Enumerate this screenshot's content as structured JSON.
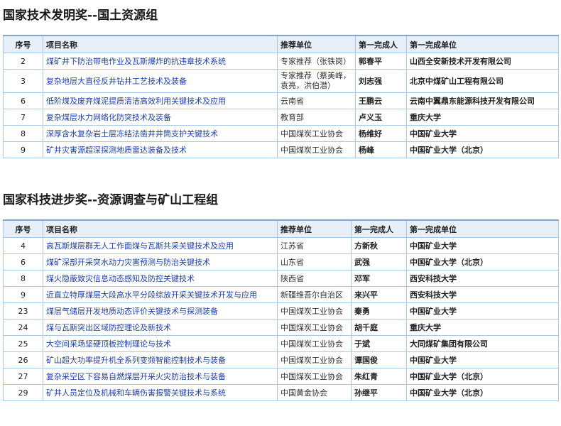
{
  "section1": {
    "title": "国家技术发明奖--国土资源组",
    "headers": [
      "序号",
      "项目名称",
      "推荐单位",
      "第一完成人",
      "第一完成单位"
    ],
    "rows": [
      {
        "no": "2",
        "name": "煤矿井下防治带电作业及瓦斯爆炸的抗违章技术系统",
        "unit": "专家推荐（张铁岗）",
        "person": "郭春平",
        "org": "山西全安新技术开发有限公司"
      },
      {
        "no": "3",
        "name": "复杂地层大直径反井钻井工艺技术及装备",
        "unit": "专家推荐（蔡美峰，袁亮，洪伯潜）",
        "person": "刘志强",
        "org": "北京中煤矿山工程有限公司"
      },
      {
        "no": "6",
        "name": "低阶煤及废弃煤泥提质清洁高效利用关键技术及应用",
        "unit": "云南省",
        "person": "王鹏云",
        "org": "云南中翼鼎东能源科技开发有限公司"
      },
      {
        "no": "7",
        "name": "复杂煤层水力网络化防突技术及装备",
        "unit": "教育部",
        "person": "卢义玉",
        "org": "重庆大学"
      },
      {
        "no": "8",
        "name": "深厚含水复杂岩土层冻结法凿井井筒支护关键技术",
        "unit": "中国煤炭工业协会",
        "person": "杨维好",
        "org": "中国矿业大学"
      },
      {
        "no": "9",
        "name": "矿井灾害源超深探测地质雷达装备及技术",
        "unit": "中国煤炭工业协会",
        "person": "杨峰",
        "org": "中国矿业大学（北京）"
      }
    ]
  },
  "section2": {
    "title": "国家科技进步奖--资源调查与矿山工程组",
    "headers": [
      "序号",
      "项目名称",
      "推荐单位",
      "第一完成人",
      "第一完成单位"
    ],
    "rows": [
      {
        "no": "4",
        "name": "高瓦斯煤层群无人工作面煤与瓦斯共采关键技术及应用",
        "unit": "江苏省",
        "person": "方新秋",
        "org": "中国矿业大学"
      },
      {
        "no": "6",
        "name": "煤矿深部开采突水动力灾害预测与防治关键技术",
        "unit": "山东省",
        "person": "武强",
        "org": "中国矿业大学（北京）"
      },
      {
        "no": "8",
        "name": "煤火隐蔽致灾信息动态感知及防控关键技术",
        "unit": "陕西省",
        "person": "邓军",
        "org": "西安科技大学"
      },
      {
        "no": "9",
        "name": "近直立特厚煤层大段高水平分段综放开采关键技术开发与应用",
        "unit": "新疆维吾尔自治区",
        "person": "来兴平",
        "org": "西安科技大学"
      },
      {
        "no": "23",
        "name": "煤层气储层开发地质动态评价关键技术与探测装备",
        "unit": "中国煤炭工业协会",
        "person": "秦勇",
        "org": "中国矿业大学"
      },
      {
        "no": "24",
        "name": "煤与瓦斯突出区域防控理论及新技术",
        "unit": "中国煤炭工业协会",
        "person": "胡千庭",
        "org": "重庆大学"
      },
      {
        "no": "25",
        "name": "大空间采场坚硬顶板控制理论与技术",
        "unit": "中国煤炭工业协会",
        "person": "于斌",
        "org": "大同煤矿集团有限公司"
      },
      {
        "no": "26",
        "name": "矿山超大功率提升机全系列变频智能控制技术与装备",
        "unit": "中国煤炭工业协会",
        "person": "谭国俊",
        "org": "中国矿业大学"
      },
      {
        "no": "27",
        "name": "复杂采空区下容易自燃煤层开采火灾防治技术与装备",
        "unit": "中国煤炭工业协会",
        "person": "朱红青",
        "org": "中国矿业大学（北京）"
      },
      {
        "no": "29",
        "name": "矿井人员定位及机械和车辆伤害报警关键技术与系统",
        "unit": "中国黄金协会",
        "person": "孙继平",
        "org": "中国矿业大学（北京）"
      }
    ]
  }
}
